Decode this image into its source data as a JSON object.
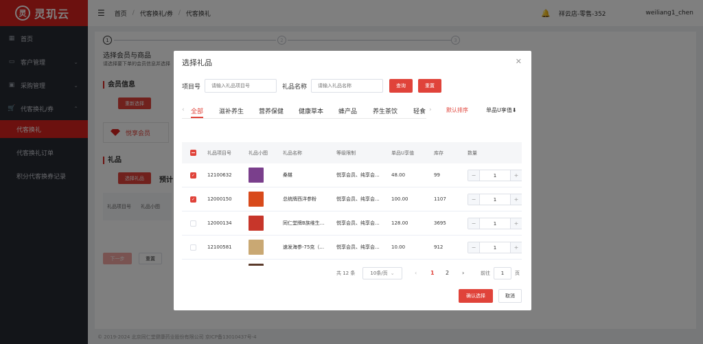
{
  "app": {
    "logo_mark": "灵",
    "logo_text": "灵玑云"
  },
  "sidebar": {
    "items": [
      {
        "label": "首页",
        "icon": "grid-icon"
      },
      {
        "label": "客户管理",
        "icon": "customer-icon"
      },
      {
        "label": "采购管理",
        "icon": "purchase-icon"
      },
      {
        "label": "代客换礼/券",
        "icon": "cart-icon"
      }
    ],
    "sub_items": [
      {
        "label": "代客换礼",
        "active": true
      },
      {
        "label": "代客换礼订单",
        "active": false
      },
      {
        "label": "积分代客换券记录",
        "active": false
      }
    ]
  },
  "header": {
    "breadcrumb": [
      "首页",
      "代客换礼/券",
      "代客换礼"
    ],
    "store": "祥云店-零售-352",
    "user": "weiliang1_chen"
  },
  "background": {
    "steps": [
      {
        "num": "1",
        "title": "选择会员与商品",
        "desc": "请选择要下单的会员信息并选择"
      },
      {
        "num": "2",
        "title": "",
        "desc": ""
      },
      {
        "num": "3",
        "title": "",
        "desc": ""
      }
    ],
    "member_section": "会员信息",
    "reselect_btn": "重新选择",
    "member_tag": "悦享会员",
    "gift_section": "礼品",
    "select_gift_btn": "选择礼品",
    "estimate_label": "预计",
    "table_cols": [
      "礼品项目号",
      "礼品小图"
    ],
    "next_btn": "下一步",
    "reset_btn": "重置",
    "footer": "© 2019-2024 北京同仁堂健康药业股份有限公司 京ICP备13010437号-4"
  },
  "modal": {
    "title": "选择礼品",
    "search": {
      "item_no_label": "项目号",
      "item_no_placeholder": "请输入礼品项目号",
      "name_label": "礼品名称",
      "name_placeholder": "请输入礼品名称",
      "query_btn": "查询",
      "reset_btn": "重置"
    },
    "tabs": [
      "全部",
      "滋补养生",
      "营养保健",
      "健康草本",
      "蜂产品",
      "养生茶饮",
      "轻食"
    ],
    "active_tab": 0,
    "sort_default": "默认排序",
    "sort_value": "单品U享值⬇",
    "columns": [
      "礼品项目号",
      "礼品小图",
      "礼品名称",
      "等级限制",
      "单品U享值",
      "库存",
      "数量"
    ],
    "rows": [
      {
        "checked": true,
        "id": "12100632",
        "thumb_color": "#7a3f8c",
        "name": "桑椹",
        "level": "悦享会员、纯享会...",
        "value": "48.00",
        "stock": "99",
        "qty": "1"
      },
      {
        "checked": true,
        "id": "12000150",
        "thumb_color": "#d84a1b",
        "name": "总统牌西洋参粉",
        "level": "悦享会员、纯享会...",
        "value": "100.00",
        "stock": "1107",
        "qty": "1"
      },
      {
        "checked": false,
        "id": "12000134",
        "thumb_color": "#c7362a",
        "name": "同仁堂牌B族维生...",
        "level": "悦享会员、纯享会...",
        "value": "128.00",
        "stock": "3695",
        "qty": "1"
      },
      {
        "checked": false,
        "id": "12100581",
        "thumb_color": "#c9a873",
        "name": "速发海参-75克（...",
        "level": "悦享会员、纯享会...",
        "value": "10.00",
        "stock": "912",
        "qty": "1"
      },
      {
        "checked": false,
        "id": "",
        "thumb_color": "#5a3a2a",
        "name": "",
        "level": "",
        "value": "",
        "stock": "",
        "qty": ""
      }
    ],
    "pagination": {
      "total": "共 12 条",
      "page_size": "10条/页",
      "pages": [
        "1",
        "2"
      ],
      "current": "1",
      "goto_label": "前往",
      "goto_value": "1",
      "page_suffix": "页"
    },
    "confirm_btn": "确认选择",
    "cancel_btn": "取消"
  },
  "colors": {
    "brand": "#d9231e",
    "accent": "#e0433a",
    "sidebar_bg": "#272a33"
  }
}
